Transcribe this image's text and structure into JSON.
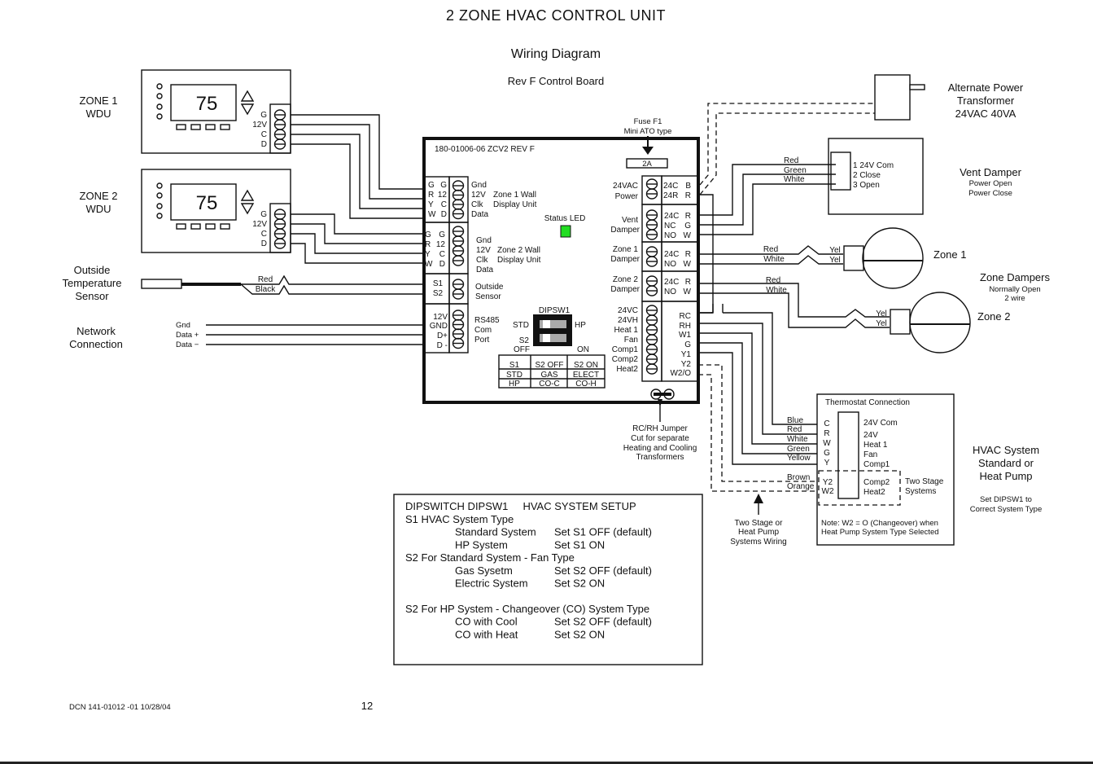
{
  "header": {
    "title": "2 ZONE HVAC CONTROL UNIT",
    "subtitle": "Wiring Diagram",
    "board_rev": "Rev F Control Board"
  },
  "zone_wdus": [
    {
      "label_line1": "ZONE 1",
      "label_line2": "WDU",
      "display": "75",
      "terminals": [
        "G",
        "12V",
        "C",
        "D"
      ]
    },
    {
      "label_line1": "ZONE 2",
      "label_line2": "WDU",
      "display": "75",
      "terminals": [
        "G",
        "12V",
        "C",
        "D"
      ]
    }
  ],
  "outside_sensor": {
    "label": [
      "Outside",
      "Temperature",
      "Sensor"
    ],
    "wires": [
      "Red",
      "Black"
    ]
  },
  "network": {
    "label": [
      "Network",
      "Connection"
    ],
    "wires": [
      "Gnd",
      "Data +",
      "Data −"
    ]
  },
  "board": {
    "part_number": "180-01006-06  ZCV2  REV F",
    "fuse_label": [
      "Fuse F1",
      "Mini ATO type"
    ],
    "fuse_value": "2A",
    "status_led": "Status LED",
    "status_led_color": "#22dd22",
    "zone1_block": {
      "left_a": [
        "G",
        "R",
        "Y",
        "W"
      ],
      "left_b": [
        "G",
        "12",
        "C",
        "D"
      ],
      "right": [
        "Gnd",
        "12V",
        "Clk",
        "Data"
      ],
      "title": [
        "Zone 1 Wall",
        "Display Unit"
      ]
    },
    "zone2_block": {
      "left_a": [
        "G",
        "R",
        "Y",
        "W"
      ],
      "left_b": [
        "G",
        "12",
        "C",
        "D"
      ],
      "right": [
        "Gnd",
        "12V",
        "Clk",
        "Data"
      ],
      "title": [
        "Zone 2 Wall",
        "Display Unit"
      ]
    },
    "sensor_block": {
      "left": [
        "S1",
        "S2"
      ],
      "right": [
        "Outside",
        "Sensor"
      ]
    },
    "rs485_block": {
      "left": [
        "12V",
        "GND",
        "D+",
        "D -"
      ],
      "right": [
        "RS485",
        "Com",
        "Port"
      ]
    },
    "dipsw": {
      "title": "DIPSW1",
      "std": "STD",
      "hp": "HP",
      "s2": "S2",
      "off": "OFF",
      "on": "ON",
      "table": [
        [
          "S1",
          "S2 OFF",
          "S2 ON"
        ],
        [
          "STD",
          "GAS",
          "ELECT"
        ],
        [
          "HP",
          "CO-C",
          "CO-H"
        ]
      ]
    },
    "right_blocks": [
      {
        "name": [
          "24VAC",
          "Power"
        ],
        "terms": [
          "24C",
          "24R"
        ],
        "codes": [
          "B",
          "R"
        ]
      },
      {
        "name": [
          "Vent",
          "Damper"
        ],
        "terms": [
          "24C",
          "NC",
          "NO"
        ],
        "codes": [
          "R",
          "G",
          "W"
        ]
      },
      {
        "name": [
          "Zone 1",
          "Damper"
        ],
        "terms": [
          "24C",
          "NO"
        ],
        "codes": [
          "R",
          "W"
        ]
      },
      {
        "name": [
          "Zone 2",
          "Damper"
        ],
        "terms": [
          "24C",
          "NO"
        ],
        "codes": [
          "R",
          "W"
        ]
      }
    ],
    "hvac_block": {
      "left": [
        "24VC",
        "24VH",
        "Heat 1",
        "Fan",
        "Comp1",
        "Comp2",
        "Heat2"
      ],
      "right": [
        "RC",
        "RH",
        "W1",
        "G",
        "Y1",
        "Y2",
        "W2/O"
      ]
    },
    "jumper_note": [
      "RC/RH Jumper",
      "Cut for separate",
      "Heating and Cooling",
      "Transformers"
    ]
  },
  "transformer": {
    "label": [
      "Alternate Power",
      "Transformer",
      "24VAC 40VA"
    ]
  },
  "vent_damper": {
    "title": "Vent Damper",
    "sub": [
      "Power Open",
      "Power Close"
    ],
    "wires": [
      "Red",
      "Green",
      "White"
    ],
    "terms": [
      "1  24V Com",
      "2  Close",
      "3 Open"
    ]
  },
  "zone_dampers": {
    "title": "Zone Dampers",
    "sub": [
      "Normally Open",
      "2 wire"
    ],
    "zone1": {
      "label": "Zone 1",
      "wires": [
        "Red",
        "White"
      ],
      "leads": [
        "Yel",
        "Yel"
      ]
    },
    "zone2": {
      "label": "Zone 2",
      "wires": [
        "Red",
        "White"
      ],
      "leads": [
        "Yel",
        "Yel"
      ]
    }
  },
  "thermostat": {
    "title": "Thermostat Connection",
    "wires": [
      "Blue",
      "Red",
      "White",
      "Green",
      "Yellow",
      "Brown",
      "Orange"
    ],
    "codes": [
      "C",
      "R",
      "W",
      "G",
      "Y",
      "Y2",
      "W2"
    ],
    "functions": [
      "24V Com",
      "24V",
      "Heat 1",
      "Fan",
      "Comp1",
      "Comp2",
      "Heat2"
    ],
    "two_stage": [
      "Two Stage",
      "Systems"
    ],
    "note": [
      "Note:  W2 = O (Changeover) when",
      "Heat Pump System Type Selected"
    ]
  },
  "two_stage_note": [
    "Two Stage or",
    "Heat Pump",
    "Systems Wiring"
  ],
  "hvac_system": {
    "title": [
      "HVAC System",
      "Standard or",
      "Heat Pump"
    ],
    "sub": [
      "Set DIPSW1 to",
      "Correct System Type"
    ]
  },
  "setup_box": {
    "heading": "DIPSWITCH DIPSW1     HVAC SYSTEM SETUP",
    "rows": [
      {
        "type": "h",
        "text": "S1  HVAC System Type"
      },
      {
        "type": "r",
        "left": "Standard System",
        "right": "Set S1 OFF (default)"
      },
      {
        "type": "r",
        "left": "HP System",
        "right": "Set S1 ON"
      },
      {
        "type": "h",
        "text": "S2  For Standard System - Fan Type"
      },
      {
        "type": "r",
        "left": "Gas Sysetm",
        "right": "Set S2 OFF (default)"
      },
      {
        "type": "r",
        "left": "Electric System",
        "right": "Set S2 ON"
      },
      {
        "type": "gap"
      },
      {
        "type": "h",
        "text": "S2  For HP System -  Changeover (CO) System Type"
      },
      {
        "type": "r",
        "left": "CO with Cool",
        "right": "Set S2 OFF (default)"
      },
      {
        "type": "r",
        "left": "CO with Heat",
        "right": "Set S2 ON"
      }
    ]
  },
  "footer": {
    "dcn": "DCN 141-01012 -01  10/28/04",
    "page": "12"
  }
}
